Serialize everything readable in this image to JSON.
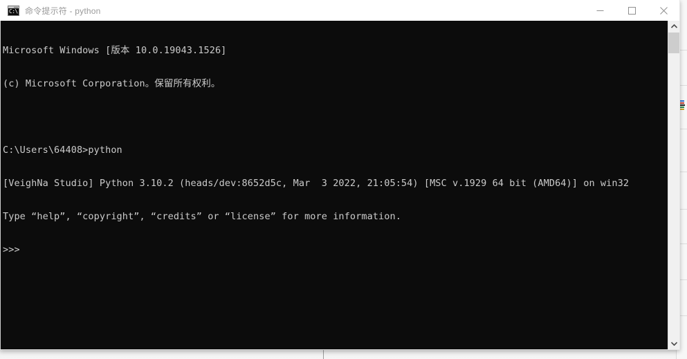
{
  "window": {
    "title": "命令提示符 - python",
    "icon": "cmd-icon",
    "icon_glyph": "C:\\",
    "controls": {
      "minimize_label": "最小化",
      "maximize_label": "最大化",
      "close_label": "关闭"
    }
  },
  "console": {
    "background_color": "#0c0c0c",
    "foreground_color": "#cccccc",
    "lines": [
      "Microsoft Windows [版本 10.0.19043.1526]",
      "(c) Microsoft Corporation。保留所有权利。",
      "",
      "C:\\Users\\64408>python",
      "[VeighNa Studio] Python 3.10.2 (heads/dev:8652d5c, Mar  3 2022, 21:05:54) [MSC v.1929 64 bit (AMD64)] on win32",
      "Type “help”, “copyright”, “credits” or “license” for more information.",
      ">>>"
    ],
    "prompt": ">>>",
    "cursor_line": 6
  },
  "scrollbar": {
    "up_arrow": "chevron-up-icon",
    "down_arrow": "chevron-down-icon",
    "thumb_color": "#cdcdcd",
    "track_color": "#f0f0f0"
  },
  "background": {
    "panel_color": "#f7f7f7",
    "row_line_color": "#dcdcdc",
    "divider_color": "#9a9a9a",
    "row_line_tops": [
      72,
      123,
      186,
      248,
      302,
      352,
      404,
      456
    ],
    "chip_colors": [
      "#2d6fd0",
      "#c0392b",
      "#2d8a4e",
      "#1f1f1f",
      "#c9a227"
    ]
  }
}
